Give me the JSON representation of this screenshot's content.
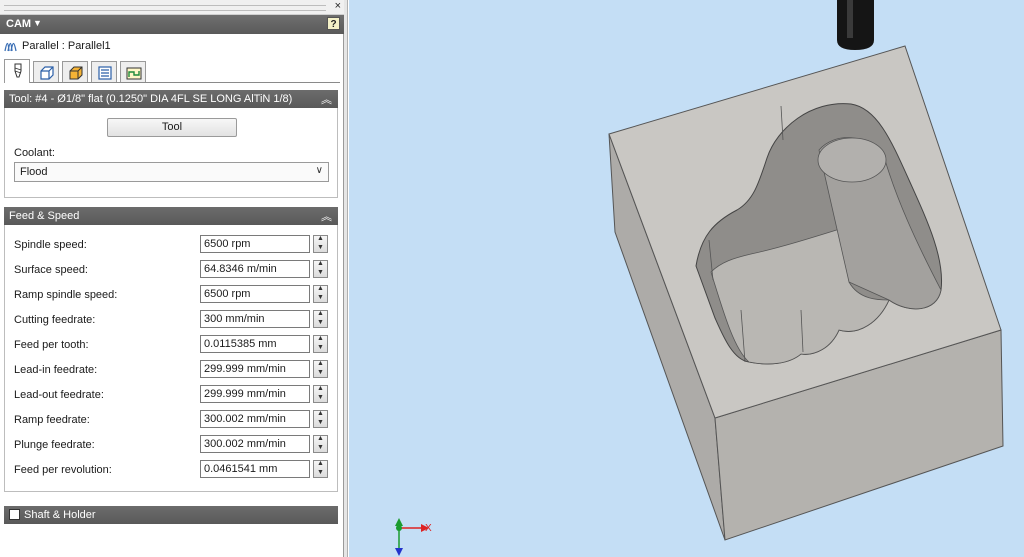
{
  "panel": {
    "title": "CAM",
    "help_label": "?",
    "close_label": "×",
    "operation": "Parallel : Parallel1",
    "tabs": [
      {
        "name": "tool-tab",
        "active": true
      },
      {
        "name": "geometry-tab",
        "active": false
      },
      {
        "name": "heights-tab",
        "active": false
      },
      {
        "name": "passes-tab",
        "active": false
      },
      {
        "name": "linking-tab",
        "active": false
      }
    ]
  },
  "tool_section": {
    "header": "Tool: #4 - Ø1/8\" flat (0.1250\" DIA 4FL SE LONG AlTiN 1/8)",
    "tool_button": "Tool",
    "coolant_label": "Coolant:",
    "coolant_value": "Flood"
  },
  "feed_section": {
    "header": "Feed & Speed",
    "rows": [
      {
        "label": "Spindle speed:",
        "value": "6500 rpm"
      },
      {
        "label": "Surface speed:",
        "value": "64.8346 m/min"
      },
      {
        "label": "Ramp spindle speed:",
        "value": "6500 rpm"
      },
      {
        "label": "Cutting feedrate:",
        "value": "300 mm/min"
      },
      {
        "label": "Feed per tooth:",
        "value": "0.0115385 mm"
      },
      {
        "label": "Lead-in feedrate:",
        "value": "299.999 mm/min"
      },
      {
        "label": "Lead-out feedrate:",
        "value": "299.999 mm/min"
      },
      {
        "label": "Ramp feedrate:",
        "value": "300.002 mm/min"
      },
      {
        "label": "Plunge feedrate:",
        "value": "300.002 mm/min"
      },
      {
        "label": "Feed per revolution:",
        "value": "0.0461541 mm"
      }
    ]
  },
  "shaft_section": {
    "header": "Shaft & Holder",
    "checked": false
  },
  "viewport": {
    "axis_x_label": "X",
    "background": "#c4def5",
    "part_color": "#c9c7c3"
  }
}
